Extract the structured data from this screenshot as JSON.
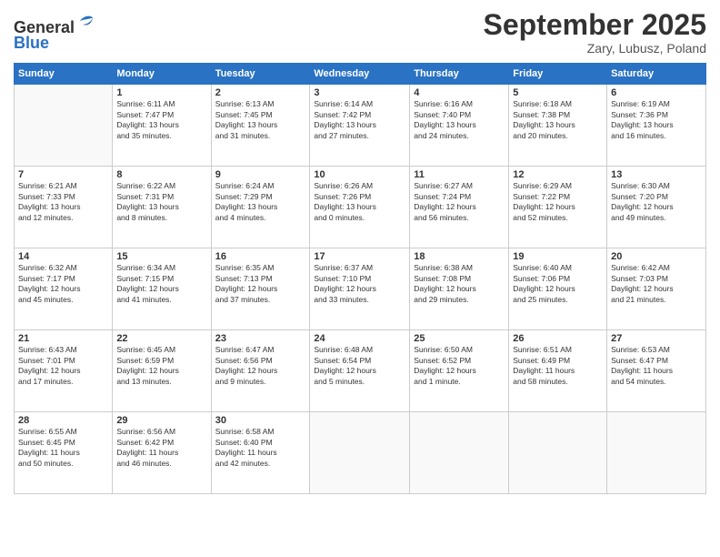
{
  "header": {
    "logo_line1": "General",
    "logo_line2": "Blue",
    "month": "September 2025",
    "location": "Zary, Lubusz, Poland"
  },
  "days_of_week": [
    "Sunday",
    "Monday",
    "Tuesday",
    "Wednesday",
    "Thursday",
    "Friday",
    "Saturday"
  ],
  "weeks": [
    [
      {
        "day": "",
        "info": ""
      },
      {
        "day": "1",
        "info": "Sunrise: 6:11 AM\nSunset: 7:47 PM\nDaylight: 13 hours\nand 35 minutes."
      },
      {
        "day": "2",
        "info": "Sunrise: 6:13 AM\nSunset: 7:45 PM\nDaylight: 13 hours\nand 31 minutes."
      },
      {
        "day": "3",
        "info": "Sunrise: 6:14 AM\nSunset: 7:42 PM\nDaylight: 13 hours\nand 27 minutes."
      },
      {
        "day": "4",
        "info": "Sunrise: 6:16 AM\nSunset: 7:40 PM\nDaylight: 13 hours\nand 24 minutes."
      },
      {
        "day": "5",
        "info": "Sunrise: 6:18 AM\nSunset: 7:38 PM\nDaylight: 13 hours\nand 20 minutes."
      },
      {
        "day": "6",
        "info": "Sunrise: 6:19 AM\nSunset: 7:36 PM\nDaylight: 13 hours\nand 16 minutes."
      }
    ],
    [
      {
        "day": "7",
        "info": "Sunrise: 6:21 AM\nSunset: 7:33 PM\nDaylight: 13 hours\nand 12 minutes."
      },
      {
        "day": "8",
        "info": "Sunrise: 6:22 AM\nSunset: 7:31 PM\nDaylight: 13 hours\nand 8 minutes."
      },
      {
        "day": "9",
        "info": "Sunrise: 6:24 AM\nSunset: 7:29 PM\nDaylight: 13 hours\nand 4 minutes."
      },
      {
        "day": "10",
        "info": "Sunrise: 6:26 AM\nSunset: 7:26 PM\nDaylight: 13 hours\nand 0 minutes."
      },
      {
        "day": "11",
        "info": "Sunrise: 6:27 AM\nSunset: 7:24 PM\nDaylight: 12 hours\nand 56 minutes."
      },
      {
        "day": "12",
        "info": "Sunrise: 6:29 AM\nSunset: 7:22 PM\nDaylight: 12 hours\nand 52 minutes."
      },
      {
        "day": "13",
        "info": "Sunrise: 6:30 AM\nSunset: 7:20 PM\nDaylight: 12 hours\nand 49 minutes."
      }
    ],
    [
      {
        "day": "14",
        "info": "Sunrise: 6:32 AM\nSunset: 7:17 PM\nDaylight: 12 hours\nand 45 minutes."
      },
      {
        "day": "15",
        "info": "Sunrise: 6:34 AM\nSunset: 7:15 PM\nDaylight: 12 hours\nand 41 minutes."
      },
      {
        "day": "16",
        "info": "Sunrise: 6:35 AM\nSunset: 7:13 PM\nDaylight: 12 hours\nand 37 minutes."
      },
      {
        "day": "17",
        "info": "Sunrise: 6:37 AM\nSunset: 7:10 PM\nDaylight: 12 hours\nand 33 minutes."
      },
      {
        "day": "18",
        "info": "Sunrise: 6:38 AM\nSunset: 7:08 PM\nDaylight: 12 hours\nand 29 minutes."
      },
      {
        "day": "19",
        "info": "Sunrise: 6:40 AM\nSunset: 7:06 PM\nDaylight: 12 hours\nand 25 minutes."
      },
      {
        "day": "20",
        "info": "Sunrise: 6:42 AM\nSunset: 7:03 PM\nDaylight: 12 hours\nand 21 minutes."
      }
    ],
    [
      {
        "day": "21",
        "info": "Sunrise: 6:43 AM\nSunset: 7:01 PM\nDaylight: 12 hours\nand 17 minutes."
      },
      {
        "day": "22",
        "info": "Sunrise: 6:45 AM\nSunset: 6:59 PM\nDaylight: 12 hours\nand 13 minutes."
      },
      {
        "day": "23",
        "info": "Sunrise: 6:47 AM\nSunset: 6:56 PM\nDaylight: 12 hours\nand 9 minutes."
      },
      {
        "day": "24",
        "info": "Sunrise: 6:48 AM\nSunset: 6:54 PM\nDaylight: 12 hours\nand 5 minutes."
      },
      {
        "day": "25",
        "info": "Sunrise: 6:50 AM\nSunset: 6:52 PM\nDaylight: 12 hours\nand 1 minute."
      },
      {
        "day": "26",
        "info": "Sunrise: 6:51 AM\nSunset: 6:49 PM\nDaylight: 11 hours\nand 58 minutes."
      },
      {
        "day": "27",
        "info": "Sunrise: 6:53 AM\nSunset: 6:47 PM\nDaylight: 11 hours\nand 54 minutes."
      }
    ],
    [
      {
        "day": "28",
        "info": "Sunrise: 6:55 AM\nSunset: 6:45 PM\nDaylight: 11 hours\nand 50 minutes."
      },
      {
        "day": "29",
        "info": "Sunrise: 6:56 AM\nSunset: 6:42 PM\nDaylight: 11 hours\nand 46 minutes."
      },
      {
        "day": "30",
        "info": "Sunrise: 6:58 AM\nSunset: 6:40 PM\nDaylight: 11 hours\nand 42 minutes."
      },
      {
        "day": "",
        "info": ""
      },
      {
        "day": "",
        "info": ""
      },
      {
        "day": "",
        "info": ""
      },
      {
        "day": "",
        "info": ""
      }
    ]
  ]
}
